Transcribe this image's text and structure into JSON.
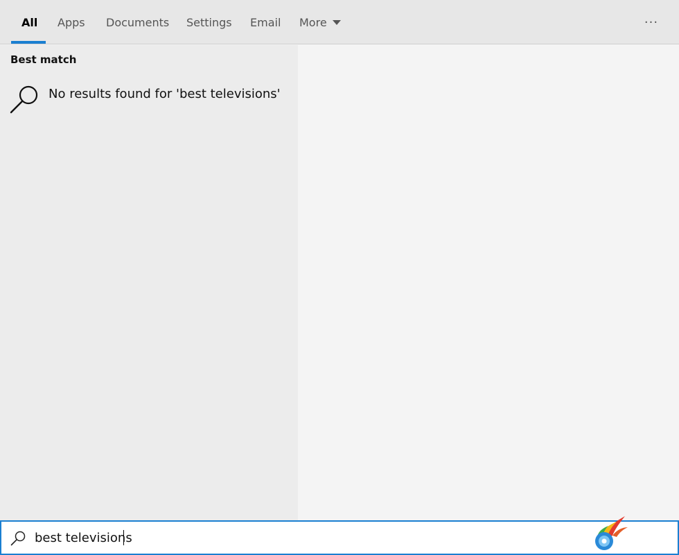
{
  "tabs": [
    {
      "label": "All",
      "active": true
    },
    {
      "label": "Apps"
    },
    {
      "label": "Documents"
    },
    {
      "label": "Settings"
    },
    {
      "label": "Email"
    },
    {
      "label": "More"
    }
  ],
  "more_menu_label": "···",
  "best_match": {
    "title": "Best match",
    "result_text": "No results found for 'best televisions'",
    "icon": "search-icon"
  },
  "search": {
    "value": "best televisions",
    "icon": "search-icon"
  },
  "colors": {
    "accent": "#1a7fd1",
    "tabbar_bg": "#e7e7e7",
    "left_pane_bg": "#ececec",
    "right_pane_bg": "#f4f4f4"
  },
  "app_logo": "colorful-flame-disc-logo"
}
